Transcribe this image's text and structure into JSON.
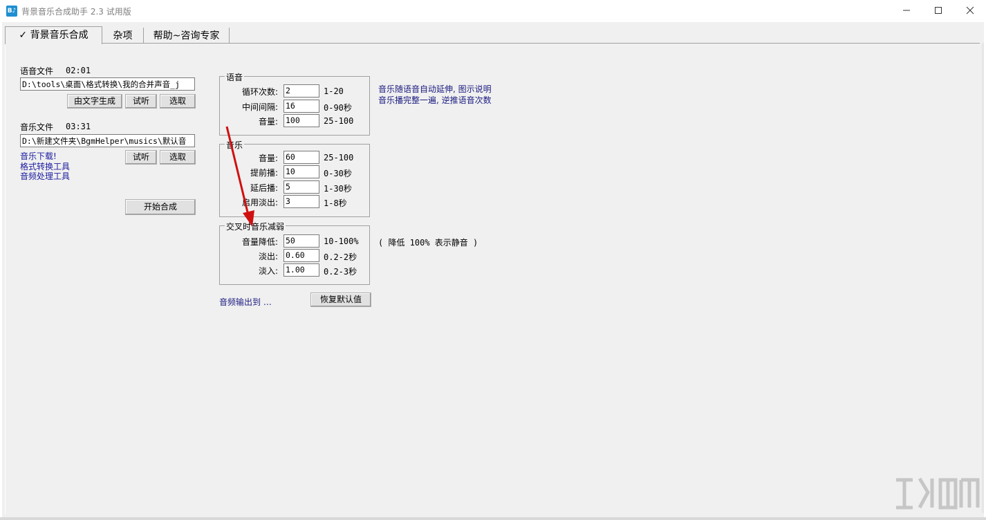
{
  "window": {
    "title": "背景音乐合成助手 2.3 试用版",
    "icon_text": "B♪",
    "controls": [
      "minimize-icon",
      "maximize-icon",
      "close-icon"
    ]
  },
  "tabs": [
    {
      "label": "背景音乐合成",
      "check": "✓",
      "active": true
    },
    {
      "label": "杂项",
      "active": false
    },
    {
      "label": "帮助~咨询专家",
      "active": false
    }
  ],
  "voice": {
    "label": "语音文件",
    "duration": "02:01",
    "path": "D:\\tools\\桌面\\格式转换\\我的合并声音_j",
    "buttons": {
      "generate": "由文字生成",
      "listen": "试听",
      "select": "选取"
    }
  },
  "music": {
    "label": "音乐文件",
    "duration": "03:31",
    "path": "D:\\新建文件夹\\BgmHelper\\musics\\默认音",
    "links": [
      "音乐下载!",
      "格式转换工具",
      "音频处理工具"
    ],
    "buttons": {
      "listen": "试听",
      "select": "选取"
    }
  },
  "start_button": "开始合成",
  "voice_group": {
    "title": "语音",
    "rows": [
      {
        "label": "循环次数:",
        "value": "2",
        "range": "1-20"
      },
      {
        "label": "中间间隔:",
        "value": "16",
        "range": "0-90秒"
      },
      {
        "label": "音量:",
        "value": "100",
        "range": "25-100"
      }
    ],
    "notes": [
      "音乐随语音自动延伸, 图示说明",
      "音乐播完整一遍, 逆推语音次数"
    ]
  },
  "music_group": {
    "title": "音乐",
    "rows": [
      {
        "label": "音量:",
        "value": "60",
        "range": "25-100"
      },
      {
        "label": "提前播:",
        "value": "10",
        "range": "0-30秒"
      },
      {
        "label": "延后播:",
        "value": "5",
        "range": "1-30秒"
      },
      {
        "label": "启用淡出:",
        "value": "3",
        "range": "1-8秒"
      }
    ]
  },
  "cross_group": {
    "title": "交叉时音乐减弱",
    "rows": [
      {
        "label": "音量降低:",
        "value": "50",
        "range": "10-100%"
      },
      {
        "label": "淡出:",
        "value": "0.60",
        "range": "0.2-2秒"
      },
      {
        "label": "淡入:",
        "value": "1.00",
        "range": "0.2-3秒"
      }
    ],
    "note": "( 降低 100% 表示静音 )"
  },
  "output_link": "音频输出到 …",
  "reset_button": "恢复默认值",
  "colors": {
    "background": "#f0f0f0",
    "link": "#1a1aa0",
    "arrow": "#d01010",
    "icon": "#1e8fd1"
  }
}
